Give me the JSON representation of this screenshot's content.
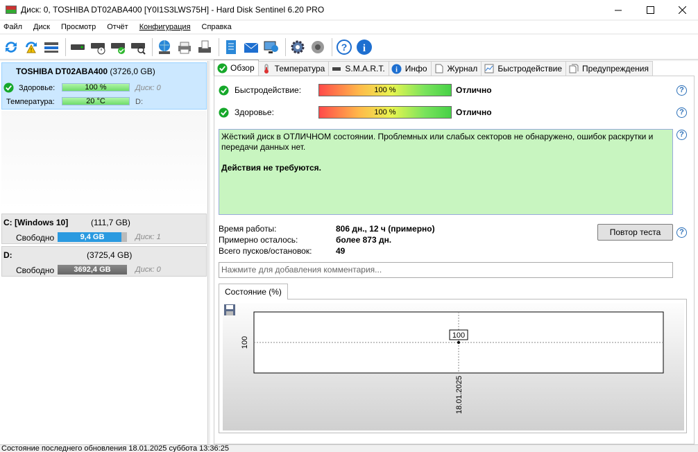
{
  "window": {
    "title": "Диск: 0, TOSHIBA DT02ABA400 [Y0I1S3LWS75H]  -  Hard Disk Sentinel 6.20 PRO"
  },
  "menu": [
    "Файл",
    "Диск",
    "Просмотр",
    "Отчёт",
    "Конфигурация",
    "Справка"
  ],
  "toolbar_icons": [
    "refresh-icon",
    "refresh-warning-icon",
    "disk-list-icon",
    "disk-info-icon",
    "disk-schedule-icon",
    "disk-check-icon",
    "disk-search-icon",
    "network-icon",
    "printer-icon",
    "disk-report-icon",
    "notes-icon",
    "email-icon",
    "web-report-icon",
    "settings-icon",
    "sound-icon",
    "help-icon",
    "info-icon"
  ],
  "disk": {
    "name": "TOSHIBA DT02ABA400",
    "capacity": "(3726,0 GB)",
    "health_label": "Здоровье:",
    "health_value": "100 %",
    "health_disk": "Диск: 0",
    "temp_label": "Температура:",
    "temp_value": "20 °C",
    "temp_disk": "D:"
  },
  "volumes": [
    {
      "name": "C: [Windows 10]",
      "size": "(111,7 GB)",
      "free_label": "Свободно",
      "free_value": "9,4 GB",
      "disk": "Диск: 1"
    },
    {
      "name": "D:",
      "size": "(3725,4 GB)",
      "free_label": "Свободно",
      "free_value": "3692,4 GB",
      "disk": "Диск: 0"
    }
  ],
  "tabs": [
    "Обзор",
    "Температура",
    "S.M.A.R.T.",
    "Инфо",
    "Журнал",
    "Быстродействие",
    "Предупреждения"
  ],
  "overview": {
    "perf_label": "Быстродействие:",
    "perf_value": "100 %",
    "perf_status": "Отлично",
    "health_label": "Здоровье:",
    "health_value": "100 %",
    "health_status": "Отлично",
    "message": "Жёсткий диск в ОТЛИЧНОМ состоянии. Проблемных или слабых секторов не обнаружено, ошибок раскрутки и передачи данных нет.",
    "action": "Действия не требуются.",
    "uptime_label": "Время работы:",
    "uptime_value": "806 дн., 12 ч (примерно)",
    "remaining_label": "Примерно осталось:",
    "remaining_value": "более 873 дн.",
    "starts_label": "Всего пусков/остановок:",
    "starts_value": "49",
    "retest_button": "Повтор теста",
    "comment_placeholder": "Нажмите для добавления комментария..."
  },
  "chart_data": {
    "type": "line",
    "tab_label": "Состояние (%)",
    "x": [
      "18.01.2025"
    ],
    "series": [
      {
        "values": [
          100
        ]
      }
    ],
    "ytick": "100",
    "data_label": "100"
  },
  "statusbar": "Состояние последнего обновления 18.01.2025 суббота 13:36:25"
}
